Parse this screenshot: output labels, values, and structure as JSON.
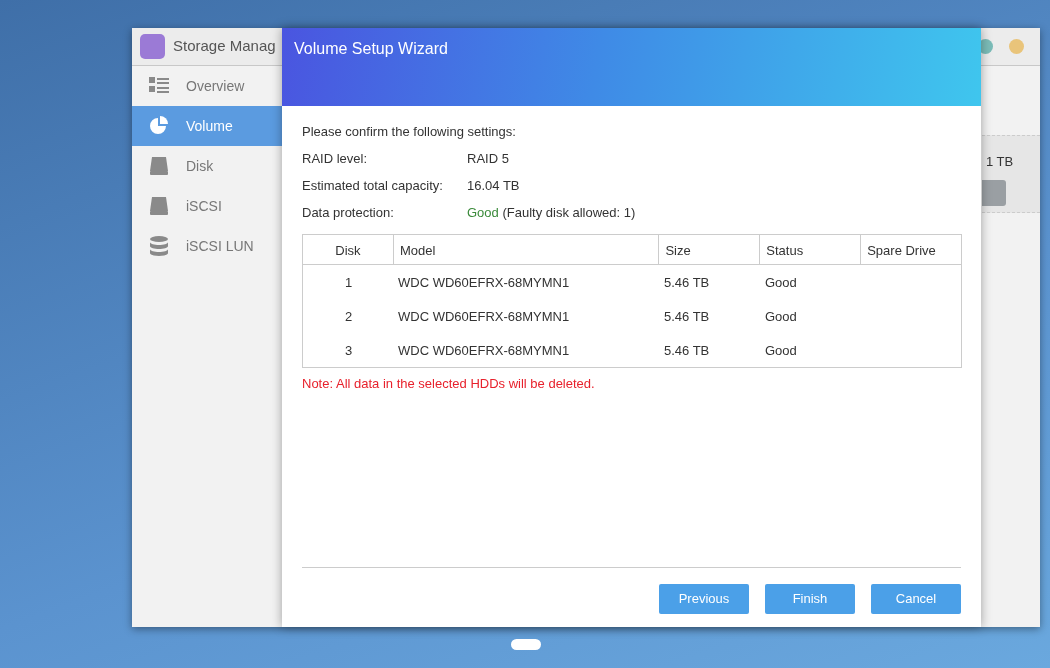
{
  "background_window": {
    "title": "Storage Manag",
    "sidebar": [
      {
        "label": "Overview",
        "kind": "list",
        "selected": false
      },
      {
        "label": "Volume",
        "kind": "pie",
        "selected": true
      },
      {
        "label": "Disk",
        "kind": "disk",
        "selected": false
      },
      {
        "label": "iSCSI",
        "kind": "iscsi",
        "selected": false
      },
      {
        "label": "iSCSI LUN",
        "kind": "stack",
        "selected": false
      }
    ],
    "panel_text": "1 TB"
  },
  "dialog": {
    "title": "Volume Setup Wizard",
    "intro": "Please confirm the following settings:",
    "settings": [
      {
        "label": "RAID level:",
        "value": "RAID 5"
      },
      {
        "label": "Estimated total capacity:",
        "value": "16.04 TB"
      },
      {
        "label": "Data protection:",
        "value": "Good",
        "detail": "(Faulty disk allowed: 1)"
      }
    ],
    "table": {
      "columns": [
        "Disk",
        "Model",
        "Size",
        "Status",
        "Spare Drive"
      ],
      "rows": [
        {
          "disk": "1",
          "model": "WDC WD60EFRX-68MYMN1",
          "size": "5.46 TB",
          "status": "Good"
        },
        {
          "disk": "2",
          "model": "WDC WD60EFRX-68MYMN1",
          "size": "5.46 TB",
          "status": "Good"
        },
        {
          "disk": "3",
          "model": "WDC WD60EFRX-68MYMN1",
          "size": "5.46 TB",
          "status": "Good"
        }
      ]
    },
    "note": "Note: All data in the selected HDDs will be deleted.",
    "buttons": [
      "Previous",
      "Finish",
      "Cancel"
    ]
  }
}
